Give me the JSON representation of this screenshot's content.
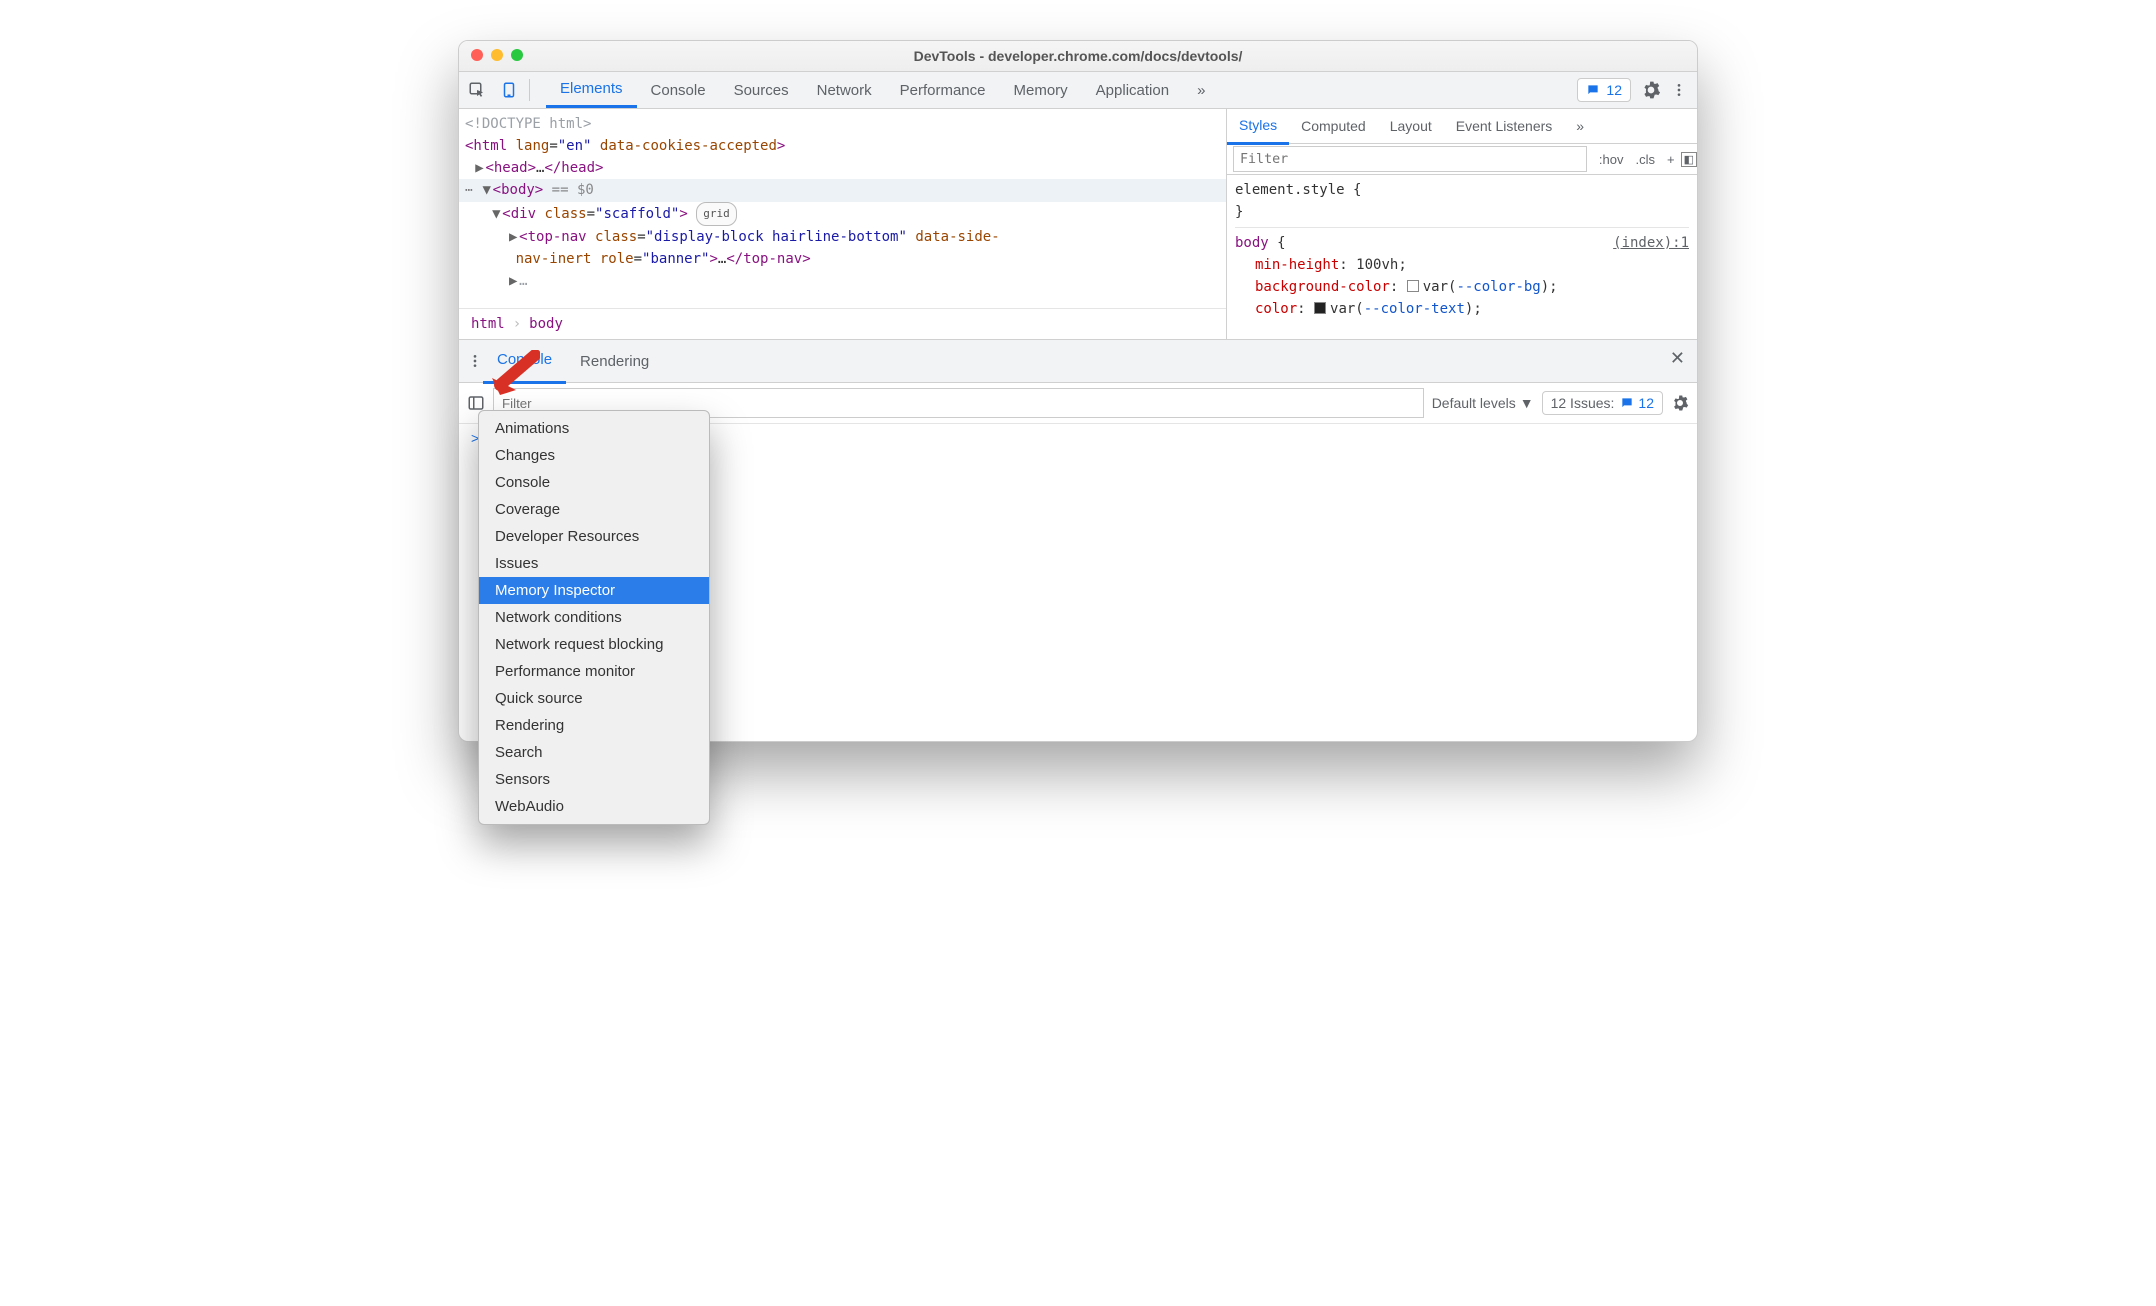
{
  "window_title": "DevTools - developer.chrome.com/docs/devtools/",
  "main_tabs": [
    "Elements",
    "Console",
    "Sources",
    "Network",
    "Performance",
    "Memory",
    "Application"
  ],
  "main_tabs_overflow": "»",
  "issue_count": "12",
  "styles_tabs": [
    "Styles",
    "Computed",
    "Layout",
    "Event Listeners"
  ],
  "styles_tabs_overflow": "»",
  "styles_filter_placeholder": "Filter",
  "styles_hov": ":hov",
  "styles_cls": ".cls",
  "rule_element_style_open": "element.style {",
  "rule_close": "}",
  "rule_body_selector": "body {",
  "rule_body_source": "(index):1",
  "rule_min_height_prop": "min-height",
  "rule_min_height_val": "100vh",
  "rule_bg_prop": "background-color",
  "rule_bg_val_var": "--color-bg",
  "rule_color_prop": "color",
  "rule_color_val_var": "--color-text",
  "dom_doctype": "<!DOCTYPE html>",
  "dom_html_open": "<html lang=\"en\" data-cookies-accepted>",
  "dom_head": "<head>…</head>",
  "dom_body": "<body>",
  "dom_body_eq": "== $0",
  "dom_div_scaffold": "<div class=\"scaffold\">",
  "dom_grid_chip": "grid",
  "dom_topnav_1": "<top-nav class=\"display-block hairline-bottom\" data-side-",
  "dom_topnav_2": "nav-inert role=\"banner\">…</top-nav>",
  "crumb_html": "html",
  "crumb_body": "body",
  "drawer_tabs": [
    "Console",
    "Rendering"
  ],
  "console_filter_placeholder": "Filter",
  "console_levels": "Default levels",
  "console_issues_label": "12 Issues:",
  "console_issues_count": "12",
  "console_prompt": ">",
  "more_tools_menu": [
    "Animations",
    "Changes",
    "Console",
    "Coverage",
    "Developer Resources",
    "Issues",
    "Memory Inspector",
    "Network conditions",
    "Network request blocking",
    "Performance monitor",
    "Quick source",
    "Rendering",
    "Search",
    "Sensors",
    "WebAudio"
  ],
  "more_tools_selected_index": 6
}
